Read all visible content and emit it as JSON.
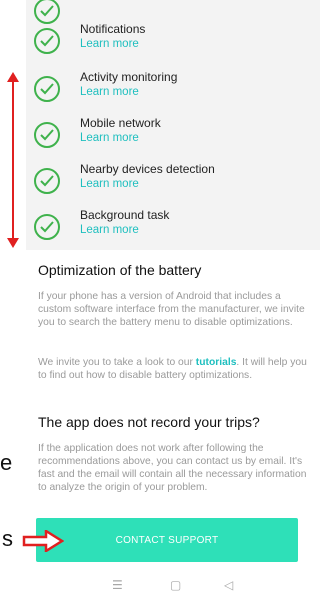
{
  "checklist": {
    "items": [
      {
        "title": "Notifications",
        "link": "Learn more"
      },
      {
        "title": "Activity monitoring",
        "link": "Learn more"
      },
      {
        "title": "Mobile network",
        "link": "Learn more"
      },
      {
        "title": "Nearby devices detection",
        "link": "Learn more"
      },
      {
        "title": "Background task",
        "link": "Learn more"
      }
    ]
  },
  "battery": {
    "title": "Optimization of the battery",
    "p1": "If your phone has a version of Android that includes a custom software interface from the manufacturer, we invite you to search the battery menu to disable optimizations.",
    "p2_before": "We invite you to take a look to our ",
    "p2_link": "tutorials",
    "p2_after": ". It will help you to find out how to disable battery optimizations."
  },
  "trips": {
    "title": "The app does not record your trips?",
    "p": "If the application does not work after following the recommendations above, you can contact us by email. It's fast and the email will contain all the necessary information to analyze the origin of your problem."
  },
  "contact_button": "CONTACT SUPPORT",
  "side_letters": {
    "e": "e",
    "s": "s"
  },
  "colors": {
    "accent": "#1fbfbf",
    "check": "#3fb24c",
    "button": "#2ee0b8",
    "annotation": "#e02020"
  },
  "icons": [
    "check-circle-icon",
    "menu-nav-icon",
    "home-nav-icon",
    "back-nav-icon",
    "red-vertical-arrow",
    "red-right-arrow"
  ]
}
